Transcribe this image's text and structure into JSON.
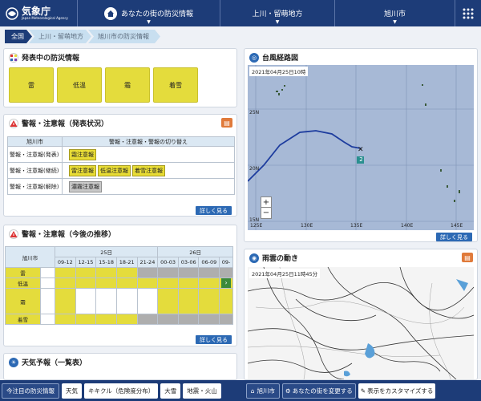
{
  "header": {
    "logo_title": "気象庁",
    "logo_sub": "Japan Meteorological Agency",
    "nav": [
      {
        "label": "あなたの街の防災情報"
      },
      {
        "label": "上川・留萌地方"
      },
      {
        "label": "旭川市"
      }
    ]
  },
  "breadcrumb": [
    "全国",
    "上川・留萌地方",
    "旭川市の防災情報"
  ],
  "alerts": {
    "title": "発表中の防災情報",
    "items": [
      "雷",
      "低温",
      "霜",
      "着雪"
    ]
  },
  "warnings": {
    "title": "警報・注意報（発表状況）",
    "head_left": "旭川市",
    "head_right": "警報・注意報・警報の切り替え",
    "rows": [
      {
        "label": "警報・注意報(発表)",
        "tags": [
          "霜注意報"
        ],
        "gray": []
      },
      {
        "label": "警報・注意報(継続)",
        "tags": [
          "雷注意報",
          "低温注意報",
          "着雪注意報"
        ],
        "gray": []
      },
      {
        "label": "警報・注意報(解除)",
        "tags": [],
        "gray": [
          "濃霧注意報"
        ]
      }
    ],
    "more": "詳しく見る"
  },
  "forecast": {
    "title": "警報・注意報（今後の推移）",
    "city": "旭川市",
    "day1": "25日",
    "day2": "26日",
    "times": [
      "09-12",
      "12-15",
      "15-18",
      "18-21",
      "21-24",
      "00-03",
      "03-06",
      "06-09",
      "09-"
    ],
    "rows": [
      "雷",
      "低温",
      "霜",
      "着雪"
    ],
    "more": "詳しく見る"
  },
  "weather": {
    "title": "天気予報（一覧表）"
  },
  "typhoon": {
    "title": "台風経路図",
    "timestamp": "2021年04月25日10時",
    "lat_labels": [
      "25N",
      "20N",
      "15N"
    ],
    "lon_labels": [
      "125E",
      "130E",
      "135E",
      "140E",
      "145E"
    ],
    "typhoon_no": "2",
    "zoom_in": "+",
    "zoom_out": "−",
    "more": "詳しく見る"
  },
  "rain": {
    "title": "雨雲の動き",
    "timestamp": "2021年04月25日11時45分"
  },
  "footer": {
    "buttons": [
      "今注目の防災情報",
      "天気",
      "キキクル（危険度分布）",
      "大雪",
      "地震・火山"
    ],
    "city": "旭川市",
    "change": "あなたの街を変更する",
    "customize": "表示をカスタマイズする"
  },
  "colors": {
    "navy": "#1d3c78",
    "warning_yellow": "#e4dc3c",
    "link_blue": "#2c69b4"
  }
}
